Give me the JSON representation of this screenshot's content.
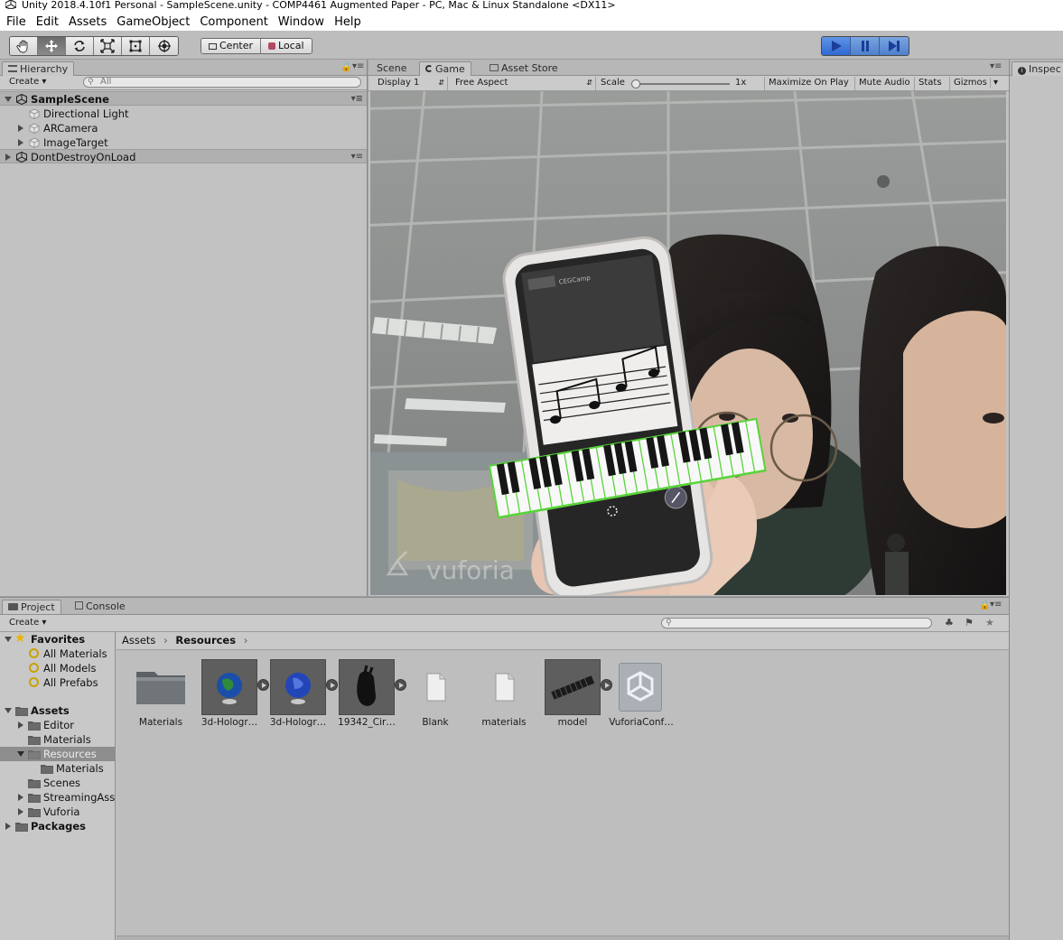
{
  "window": {
    "title": "Unity 2018.4.10f1 Personal - SampleScene.unity - COMP4461 Augmented Paper - PC, Mac & Linux Standalone <DX11>"
  },
  "menu": [
    "File",
    "Edit",
    "Assets",
    "GameObject",
    "Component",
    "Window",
    "Help"
  ],
  "toolbar": {
    "pivot_mode": "Center",
    "pivot_space": "Local",
    "tools": [
      "hand-tool",
      "move-tool",
      "rotate-tool",
      "scale-tool",
      "rect-tool",
      "transform-tool"
    ],
    "play_state": "playing"
  },
  "hierarchy": {
    "tab": "Hierarchy",
    "create": "Create",
    "search_placeholder": "All",
    "scenes": [
      {
        "name": "SampleScene",
        "children": [
          "Directional Light",
          "ARCamera",
          "ImageTarget"
        ]
      },
      {
        "name": "DontDestroyOnLoad",
        "children": []
      }
    ]
  },
  "game": {
    "tabs": [
      "Scene",
      "Game",
      "Asset Store"
    ],
    "active_tab": "Game",
    "display": "Display 1",
    "aspect": "Free Aspect",
    "scale_label": "Scale",
    "scale_value": "1x",
    "options": [
      "Maximize On Play",
      "Mute Audio",
      "Stats",
      "Gizmos"
    ],
    "phone_app_label": "CEGCamp",
    "watermark": "vuforia"
  },
  "inspector": {
    "tab": "Inspec"
  },
  "project": {
    "tabs": [
      "Project",
      "Console"
    ],
    "create": "Create",
    "favorites": {
      "label": "Favorites",
      "items": [
        "All Materials",
        "All Models",
        "All Prefabs"
      ]
    },
    "assets_root": "Assets",
    "tree": [
      "Editor",
      "Materials",
      "Resources",
      "Materials",
      "Scenes",
      "StreamingAss",
      "Vuforia"
    ],
    "packages": "Packages",
    "breadcrumb": [
      "Assets",
      "Resources"
    ],
    "items": [
      {
        "name": "Materials",
        "kind": "folder"
      },
      {
        "name": "3d-Hologr…",
        "kind": "globe"
      },
      {
        "name": "3d-Hologr…",
        "kind": "globe2"
      },
      {
        "name": "19342_Cir…",
        "kind": "hand"
      },
      {
        "name": "Blank",
        "kind": "file"
      },
      {
        "name": "materials",
        "kind": "file"
      },
      {
        "name": "model",
        "kind": "keyboard"
      },
      {
        "name": "VuforiaConf…",
        "kind": "unity"
      }
    ]
  },
  "colors": {
    "play_blue": "#2f6ad2",
    "keyboard_outline": "#59d43a",
    "selection": "#8e8e8e"
  }
}
